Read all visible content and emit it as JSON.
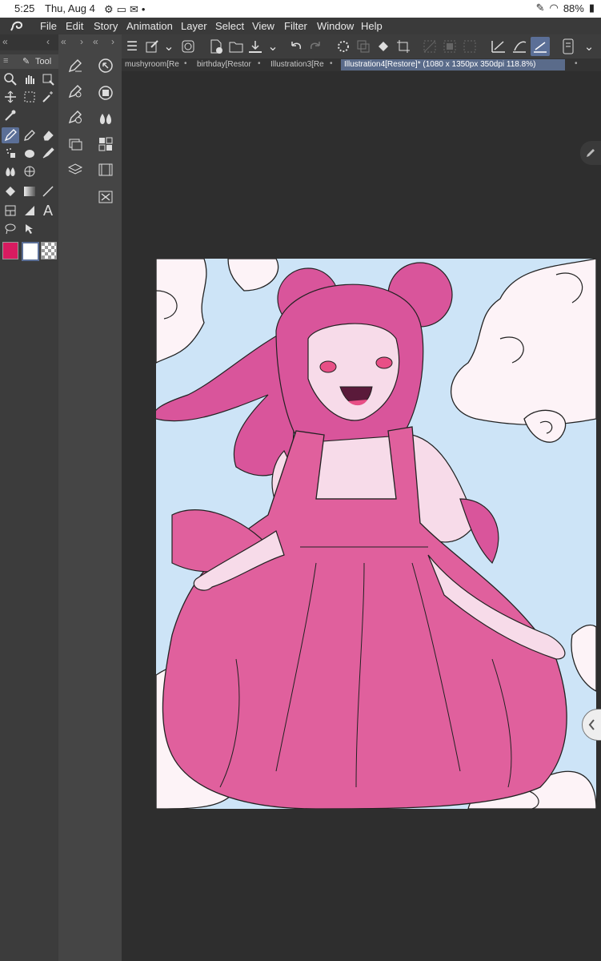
{
  "status": {
    "time": "5:25",
    "date": "Thu, Aug 4",
    "dot": "•",
    "battery": "88%"
  },
  "menu": [
    "File",
    "Edit",
    "Story",
    "Animation",
    "Layer",
    "Select",
    "View",
    "Filter",
    "Window",
    "Help"
  ],
  "tool_palette": {
    "title": "Tool"
  },
  "tabs": [
    {
      "label": "mushyroom[Re",
      "active": false
    },
    {
      "label": "birthday[Restor",
      "active": false
    },
    {
      "label": "Illustration3[Re",
      "active": false
    },
    {
      "label": "Illustration4[Restore]* (1080 x 1350px 350dpi 118.8%)",
      "active": true
    }
  ],
  "colors": {
    "main": "#d81b60",
    "sub": "#ffffff",
    "accent": "#5b6f97",
    "skin": "#f7dbe9",
    "hair": "#d9559b",
    "sky": "#cde4f7"
  }
}
